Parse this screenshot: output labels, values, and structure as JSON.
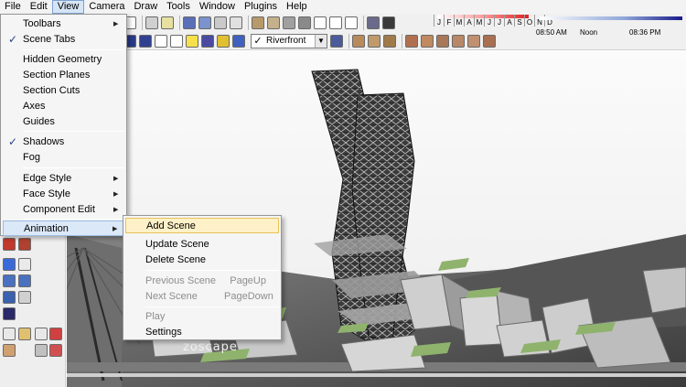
{
  "menubar": [
    "File",
    "Edit",
    "View",
    "Camera",
    "Draw",
    "Tools",
    "Window",
    "Plugins",
    "Help"
  ],
  "view_menu": {
    "toolbars": "Toolbars",
    "scene_tabs": "Scene Tabs",
    "hidden_geometry": "Hidden Geometry",
    "section_planes": "Section Planes",
    "section_cuts": "Section Cuts",
    "axes": "Axes",
    "guides": "Guides",
    "shadows": "Shadows",
    "fog": "Fog",
    "edge_style": "Edge Style",
    "face_style": "Face Style",
    "component_edit": "Component Edit",
    "animation": "Animation"
  },
  "animation_menu": {
    "add_scene": "Add Scene",
    "update_scene": "Update Scene",
    "delete_scene": "Delete Scene",
    "previous_scene": "Previous Scene",
    "previous_scene_shortcut": "PageUp",
    "next_scene": "Next Scene",
    "next_scene_shortcut": "PageDown",
    "play": "Play",
    "settings": "Settings"
  },
  "scene_selector": {
    "checked": "✓",
    "value": "Riverfront"
  },
  "shadow_settings": {
    "months": [
      "J",
      "F",
      "M",
      "A",
      "M",
      "J",
      "J",
      "A",
      "S",
      "O",
      "N",
      "D"
    ],
    "time_start": "08:50 AM",
    "time_mid": "Noon",
    "time_end": "08:36 PM"
  },
  "watermark": "zoscape",
  "colors": {
    "highlight": "#fff1c7",
    "highlight_border": "#e8c25a",
    "check": "#2a3f8a",
    "grass": "#8fb36d"
  }
}
